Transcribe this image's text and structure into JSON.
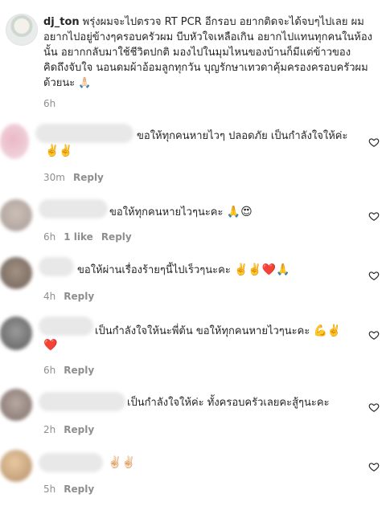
{
  "post": {
    "username": "dj_ton",
    "caption": "พรุ่งผมจะไปตรวจ RT PCR อีกรอบ อยากติดจะได้จบๆไปเลย ผมอยากไปอยู่ข้างๆครอบครัวผม บีบหัวใจเหลือเกิน อยากไปแทนทุกคนในห้องนั้น อยากกลับมาใช้ชีวิตปกติ มองไปในมุมไหนของบ้านก็มีแต่ข้าวของคิดถึงจับใจ นอนดมผ้าอ้อมลูกทุกวัน บุญรักษาเทวดาคุ้มครองครอบครัวผมด้วยนะ 🙏🏻",
    "time": "6h"
  },
  "comments": [
    {
      "text": "ขอให้ทุกคนหายไวๆ ปลอดภัย เป็นกำลังใจให้ค่ะ",
      "emoji": "✌️✌️",
      "time": "30m",
      "likes": "",
      "reply": "Reply",
      "avatar_color": "#e7b4c2"
    },
    {
      "text": "ขอให้ทุกคนหายไวๆนะคะ",
      "emoji": "🙏😍",
      "time": "6h",
      "likes": "1 like",
      "reply": "Reply",
      "avatar_color": "#b9aca7"
    },
    {
      "text": "ขอให้ผ่านเรื่องร้ายๆนี้ไปเร็วๆนะคะ",
      "emoji": "✌️✌️❤️🙏",
      "time": "4h",
      "likes": "",
      "reply": "Reply",
      "avatar_color": "#8d7e74"
    },
    {
      "text": "เป็นกำลังใจให้นะพี่ต้น ขอให้ทุกคนหายไวๆนะคะ",
      "emoji": "💪✌️",
      "emoji2": "❤️",
      "time": "6h",
      "likes": "",
      "reply": "Reply",
      "avatar_color": "#6f6f6f"
    },
    {
      "text": "เป็นกำลังใจให้ค่ะ ทั้งครอบครัวเลยคะสู้ๆนะคะ",
      "emoji": "",
      "time": "2h",
      "likes": "",
      "reply": "Reply",
      "avatar_color": "#9c8d88"
    },
    {
      "text": "",
      "emoji": "✌🏻✌🏻",
      "time": "5h",
      "likes": "",
      "reply": "Reply",
      "avatar_color": "#d5a77c"
    }
  ]
}
